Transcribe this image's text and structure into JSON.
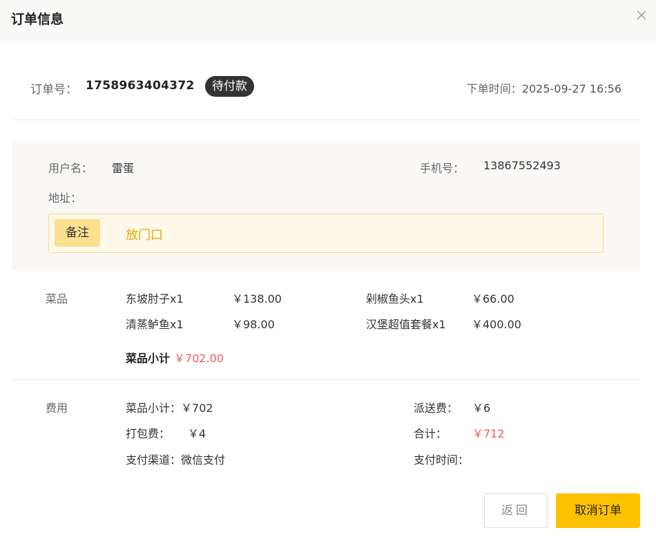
{
  "header": {
    "title": "订单信息"
  },
  "order": {
    "number_label": "订单号：",
    "number": "1758963404372",
    "status": "待付款",
    "time_label": "下单时间：",
    "time": "2025-09-27 16:56"
  },
  "user": {
    "name_label": "用户名：",
    "name": "雷蛋",
    "phone_label": "手机号：",
    "phone": "13867552493",
    "address_label": "地址：",
    "address": ""
  },
  "remark": {
    "tag": "备注",
    "text": "放门口"
  },
  "dishes": {
    "label": "菜品",
    "items": [
      {
        "name": "东坡肘子x1",
        "price": "￥138.00"
      },
      {
        "name": "剁椒鱼头x1",
        "price": "￥66.00"
      },
      {
        "name": "清蒸鲈鱼x1",
        "price": "￥98.00"
      },
      {
        "name": "汉堡超值套餐x1",
        "price": "￥400.00"
      }
    ],
    "subtotal_label": "菜品小计",
    "subtotal": "￥702.00"
  },
  "fees": {
    "label": "费用",
    "dish_subtotal_label": "菜品小计：",
    "dish_subtotal": "￥702",
    "delivery_label": "派送费：",
    "delivery": "￥6",
    "packing_label": "打包费：",
    "packing": "￥4",
    "total_label": "合计：",
    "total": "￥712",
    "pay_channel_label": "支付渠道：",
    "pay_channel": "微信支付",
    "pay_time_label": "支付时间：",
    "pay_time": ""
  },
  "actions": {
    "back": "返回",
    "cancel": "取消订单"
  },
  "colors": {
    "accent": "#ffc200",
    "price_red": "#f05a5a",
    "remark_text": "#e8a800"
  }
}
